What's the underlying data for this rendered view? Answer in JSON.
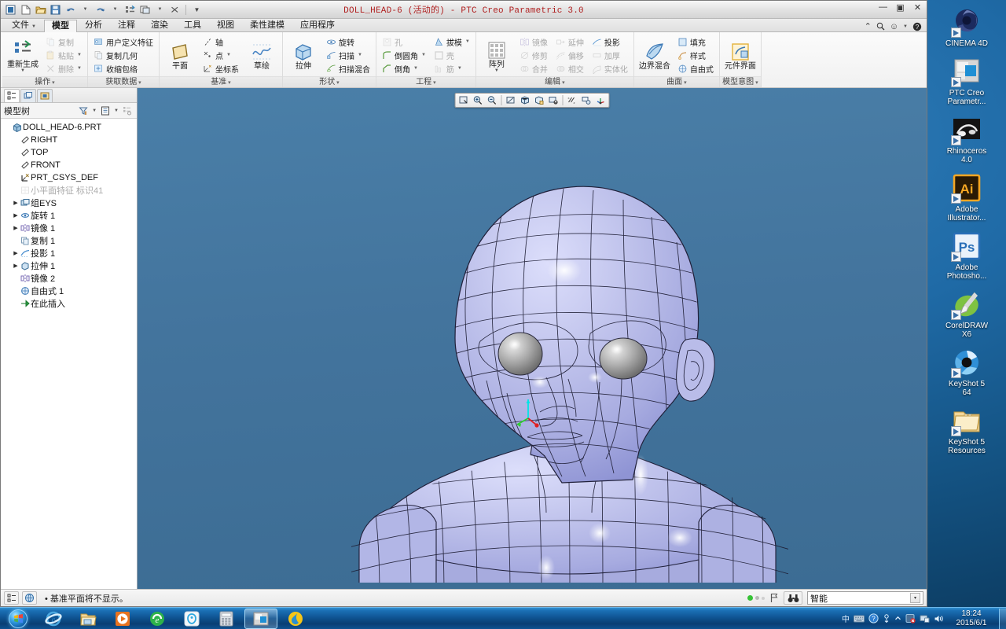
{
  "window": {
    "title": "DOLL_HEAD-6 (活动的) - PTC Creo Parametric 3.0",
    "minimize": "—",
    "maximize": "▣",
    "close": "✕"
  },
  "quick_access": [
    {
      "name": "app-menu-icon",
      "glyph": "▣"
    },
    {
      "name": "new-file-icon",
      "glyph": "file"
    },
    {
      "name": "open-file-icon",
      "glyph": "folder"
    },
    {
      "name": "save-icon",
      "glyph": "save"
    },
    {
      "name": "undo-icon",
      "glyph": "undo"
    },
    {
      "name": "redo-icon",
      "glyph": "redo"
    },
    {
      "name": "regenerate-icon",
      "glyph": "regen"
    },
    {
      "name": "window-switch-icon",
      "glyph": "windows"
    },
    {
      "name": "close-window-icon",
      "glyph": "closewin"
    },
    {
      "name": "customize-qat-icon",
      "glyph": "caret"
    }
  ],
  "tabs": [
    {
      "label": "文件",
      "dropdown": true,
      "active": false
    },
    {
      "label": "模型",
      "dropdown": false,
      "active": true
    },
    {
      "label": "分析",
      "dropdown": false,
      "active": false
    },
    {
      "label": "注释",
      "dropdown": false,
      "active": false
    },
    {
      "label": "渲染",
      "dropdown": false,
      "active": false
    },
    {
      "label": "工具",
      "dropdown": false,
      "active": false
    },
    {
      "label": "视图",
      "dropdown": false,
      "active": false
    },
    {
      "label": "柔性建模",
      "dropdown": false,
      "active": false
    },
    {
      "label": "应用程序",
      "dropdown": false,
      "active": false
    }
  ],
  "tabs_right": {
    "collapse": "⌃",
    "search": "search-icon",
    "smiley": "☺",
    "help": "?"
  },
  "ribbon_groups": [
    {
      "label": "操作",
      "big": {
        "name": "regenerate-button",
        "caption": "重新生成",
        "dropdown": true
      },
      "small": [
        {
          "label": "复制",
          "disabled": true,
          "dropdown": false,
          "icon": "copy-icon"
        },
        {
          "label": "粘贴",
          "disabled": true,
          "dropdown": true,
          "icon": "paste-icon"
        },
        {
          "label": "删除",
          "disabled": true,
          "dropdown": true,
          "icon": "delete-icon"
        }
      ]
    },
    {
      "label": "获取数据",
      "big": null,
      "small": [
        {
          "label": "用户定义特征",
          "disabled": false,
          "dropdown": false,
          "icon": "udf-icon"
        },
        {
          "label": "复制几何",
          "disabled": false,
          "dropdown": false,
          "icon": "copy-geom-icon"
        },
        {
          "label": "收缩包络",
          "disabled": false,
          "dropdown": false,
          "icon": "shrinkwrap-icon"
        }
      ]
    },
    {
      "label": "基准",
      "big": {
        "name": "plane-button",
        "caption": "平面",
        "dropdown": false
      },
      "small": [
        {
          "label": "轴",
          "disabled": false,
          "dropdown": false,
          "icon": "axis-icon"
        },
        {
          "label": "点",
          "disabled": false,
          "dropdown": true,
          "icon": "point-icon"
        },
        {
          "label": "坐标系",
          "disabled": false,
          "dropdown": false,
          "icon": "csys-icon"
        }
      ],
      "big2": {
        "name": "sketch-button",
        "caption": "草绘",
        "dropdown": false
      }
    },
    {
      "label": "形状",
      "big": {
        "name": "extrude-button",
        "caption": "拉伸",
        "dropdown": false
      },
      "small": [
        {
          "label": "旋转",
          "disabled": false,
          "dropdown": false,
          "icon": "revolve-icon"
        },
        {
          "label": "扫描",
          "disabled": false,
          "dropdown": true,
          "icon": "sweep-icon"
        },
        {
          "label": "扫描混合",
          "disabled": false,
          "dropdown": false,
          "icon": "swept-blend-icon"
        }
      ]
    },
    {
      "label": "工程",
      "big": null,
      "small": [
        {
          "label": "孔",
          "disabled": true,
          "dropdown": false,
          "icon": "hole-icon"
        },
        {
          "label": "倒圆角",
          "disabled": false,
          "dropdown": true,
          "icon": "round-icon"
        },
        {
          "label": "倒角",
          "disabled": false,
          "dropdown": true,
          "icon": "chamfer-icon"
        }
      ],
      "small2": [
        {
          "label": "拔模",
          "disabled": false,
          "dropdown": true,
          "icon": "draft-icon"
        },
        {
          "label": "壳",
          "disabled": true,
          "dropdown": false,
          "icon": "shell-icon"
        },
        {
          "label": "筋",
          "disabled": true,
          "dropdown": true,
          "icon": "rib-icon"
        }
      ]
    },
    {
      "label": "编辑",
      "big": {
        "name": "pattern-button",
        "caption": "阵列",
        "dropdown": true
      },
      "small": [
        {
          "label": "镜像",
          "disabled": true,
          "dropdown": false,
          "icon": "mirror-icon"
        },
        {
          "label": "修剪",
          "disabled": true,
          "dropdown": false,
          "icon": "trim-icon"
        },
        {
          "label": "合并",
          "disabled": true,
          "dropdown": false,
          "icon": "merge-icon"
        }
      ],
      "small2": [
        {
          "label": "延伸",
          "disabled": true,
          "dropdown": false,
          "icon": "extend-icon"
        },
        {
          "label": "偏移",
          "disabled": true,
          "dropdown": false,
          "icon": "offset-icon"
        },
        {
          "label": "相交",
          "disabled": true,
          "dropdown": false,
          "icon": "intersect-icon"
        }
      ],
      "small3": [
        {
          "label": "投影",
          "disabled": false,
          "dropdown": false,
          "icon": "project-icon"
        },
        {
          "label": "加厚",
          "disabled": true,
          "dropdown": false,
          "icon": "thicken-icon"
        },
        {
          "label": "实体化",
          "disabled": true,
          "dropdown": false,
          "icon": "solidify-icon"
        }
      ]
    },
    {
      "label": "曲面",
      "big": {
        "name": "boundary-blend-button",
        "caption": "边界混合",
        "dropdown": false
      },
      "small": [
        {
          "label": "填充",
          "disabled": false,
          "dropdown": false,
          "icon": "fill-icon"
        },
        {
          "label": "样式",
          "disabled": false,
          "dropdown": false,
          "icon": "style-icon"
        },
        {
          "label": "自由式",
          "disabled": false,
          "dropdown": false,
          "icon": "freestyle-icon"
        }
      ]
    },
    {
      "label": "模型意图",
      "big": {
        "name": "component-interface-button",
        "caption": "元件界面",
        "dropdown": false
      },
      "small": []
    }
  ],
  "tree_panel": {
    "tabs": [
      {
        "name": "model-tree-tab",
        "active": true
      },
      {
        "name": "layer-tree-tab",
        "active": false
      },
      {
        "name": "folder-browser-tab",
        "active": false
      }
    ],
    "title": "模型树",
    "toolbar": [
      {
        "name": "tree-filter-icon",
        "dropdown": true
      },
      {
        "name": "tree-settings-icon",
        "dropdown": true
      },
      {
        "name": "tree-columns-icon",
        "dropdown": false
      }
    ],
    "nodes": [
      {
        "label": "DOLL_HEAD-6.PRT",
        "indent": 0,
        "expand": "",
        "icon": "part-icon",
        "dim": false
      },
      {
        "label": "RIGHT",
        "indent": 1,
        "expand": "",
        "icon": "plane-icon",
        "dim": false
      },
      {
        "label": "TOP",
        "indent": 1,
        "expand": "",
        "icon": "plane-icon",
        "dim": false
      },
      {
        "label": "FRONT",
        "indent": 1,
        "expand": "",
        "icon": "plane-icon",
        "dim": false
      },
      {
        "label": "PRT_CSYS_DEF",
        "indent": 1,
        "expand": "",
        "icon": "csys-icon",
        "dim": false
      },
      {
        "label": "小平面特征 标识41",
        "indent": 1,
        "expand": "",
        "icon": "facet-icon",
        "dim": true
      },
      {
        "label": "组EYS",
        "indent": 1,
        "expand": "▶",
        "icon": "group-icon",
        "dim": false
      },
      {
        "label": "旋转 1",
        "indent": 1,
        "expand": "▶",
        "icon": "revolve-icon",
        "dim": false
      },
      {
        "label": "镜像 1",
        "indent": 1,
        "expand": "▶",
        "icon": "mirror-icon",
        "dim": false
      },
      {
        "label": "复制 1",
        "indent": 1,
        "expand": "",
        "icon": "copy-icon",
        "dim": false
      },
      {
        "label": "投影 1",
        "indent": 1,
        "expand": "▶",
        "icon": "project-icon",
        "dim": false
      },
      {
        "label": "拉伸 1",
        "indent": 1,
        "expand": "▶",
        "icon": "extrude-icon",
        "dim": false
      },
      {
        "label": "镜像 2",
        "indent": 1,
        "expand": "",
        "icon": "mirror-icon",
        "dim": false
      },
      {
        "label": "自由式 1",
        "indent": 1,
        "expand": "",
        "icon": "freestyle-icon",
        "dim": false
      },
      {
        "label": "在此插入",
        "indent": 1,
        "expand": "",
        "icon": "insert-here-icon",
        "dim": false
      }
    ]
  },
  "viewport": {
    "graphics_toolbar": [
      {
        "name": "refit-icon"
      },
      {
        "name": "zoom-in-icon"
      },
      {
        "name": "zoom-out-icon"
      },
      {
        "name": "repaint-icon"
      },
      {
        "name": "display-style-icon"
      },
      {
        "name": "saved-views-icon"
      },
      {
        "name": "view-manager-icon"
      },
      {
        "name": "datum-display-icon"
      },
      {
        "name": "annotation-display-icon"
      },
      {
        "name": "spin-center-icon"
      }
    ],
    "model_name": "DOLL_HEAD-6",
    "background_top": "#4a7fa8",
    "background_bottom": "#3c6c93",
    "surface_color": "#b8bbe6",
    "wire_color": "#1a1a2a",
    "eye_color": "#9b9b9b",
    "csys_axes": {
      "z": "#00e5e5",
      "y": "#2ad02a",
      "x": "#e02020"
    }
  },
  "statusbar": {
    "buttons": [
      {
        "name": "model-tree-toggle-icon"
      },
      {
        "name": "web-browser-toggle-icon"
      }
    ],
    "message": "• 基准平面将不显示。",
    "search_icon": "binoculars-icon",
    "flag_icon": "flag-icon",
    "selection_filter": "智能",
    "dropdown_arrow": "▾"
  },
  "desktop_icons": [
    {
      "label": "CINEMA 4D",
      "name": "cinema-4d-icon"
    },
    {
      "label": "PTC Creo\nParametr...",
      "name": "ptc-creo-parametric-icon"
    },
    {
      "label": "Rhinoceros\n4.0",
      "name": "rhinoceros-icon"
    },
    {
      "label": "Adobe\nIllustrator...",
      "name": "adobe-illustrator-icon"
    },
    {
      "label": "Adobe\nPhotosho...",
      "name": "adobe-photoshop-icon"
    },
    {
      "label": "CorelDRAW\nX6",
      "name": "coreldraw-icon"
    },
    {
      "label": "KeyShot 5\n64",
      "name": "keyshot-5-icon"
    },
    {
      "label": "KeyShot 5\nResources",
      "name": "keyshot-5-resources-folder-icon"
    }
  ],
  "taskbar": {
    "start": "start-orb",
    "items": [
      {
        "name": "internet-explorer-taskbar-icon",
        "pressed": false
      },
      {
        "name": "windows-explorer-taskbar-icon",
        "pressed": false
      },
      {
        "name": "media-player-taskbar-icon",
        "pressed": false
      },
      {
        "name": "360-browser-taskbar-icon",
        "pressed": false
      },
      {
        "name": "qq-taskbar-icon",
        "pressed": false
      },
      {
        "name": "calculator-taskbar-icon",
        "pressed": false
      },
      {
        "name": "creo-parametric-taskbar-icon",
        "pressed": true
      },
      {
        "name": "kugou-music-taskbar-icon",
        "pressed": false
      }
    ],
    "tray": [
      {
        "name": "ime-indicator",
        "glyph": "中"
      },
      {
        "name": "ime-keyboard-icon",
        "glyph": "⌨"
      },
      {
        "name": "help-tray-icon",
        "glyph": "?"
      },
      {
        "name": "ime-toolbar-icon",
        "glyph": "⚙"
      },
      {
        "name": "show-hidden-icons-arrow",
        "glyph": "▲"
      },
      {
        "name": "antivirus-tray-icon",
        "glyph": "✕"
      },
      {
        "name": "network-tray-icon",
        "glyph": "▤"
      },
      {
        "name": "volume-tray-icon",
        "glyph": "🔊"
      }
    ],
    "clock_time": "18:24",
    "clock_date": "2015/6/1"
  }
}
